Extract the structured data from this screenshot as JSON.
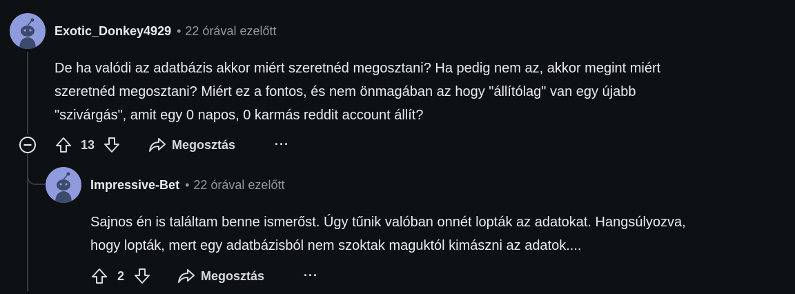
{
  "comments": [
    {
      "author": "Exotic_Donkey4929",
      "separator": "•",
      "time": "22 órával ezelőtt",
      "body": "De ha valódi az adatbázis akkor miért szeretnéd megosztani? Ha pedig nem az, akkor megint miért\nszeretnéd megosztani? Miért ez a fontos, és nem önmagában az hogy \"állítólag\" van egy újabb\n\"szivárgás\", amit egy 0 napos, 0 karmás reddit account állít?",
      "score": "13",
      "share_label": "Megosztás",
      "more_label": "···"
    },
    {
      "author": "Impressive-Bet",
      "separator": "•",
      "time": "22 órával ezelőtt",
      "body": "Sajnos én is találtam benne ismerőst. Úgy tűnik valóban onnét lopták az adatokat. Hangsúlyozva,\nhogy lopták, mert egy adatbázisból nem szoktak maguktól kimászni az adatok....",
      "score": "2",
      "share_label": "Megosztás",
      "more_label": "···"
    }
  ],
  "colors": {
    "background": "#0e1113",
    "avatar": "#8e9bdc",
    "text": "#e8ecee",
    "muted": "#8f9aa0",
    "thread_line": "#333d42"
  },
  "icons": [
    "snoo-avatar-icon",
    "upvote-icon",
    "downvote-icon",
    "share-icon",
    "collapse-minus-icon"
  ]
}
